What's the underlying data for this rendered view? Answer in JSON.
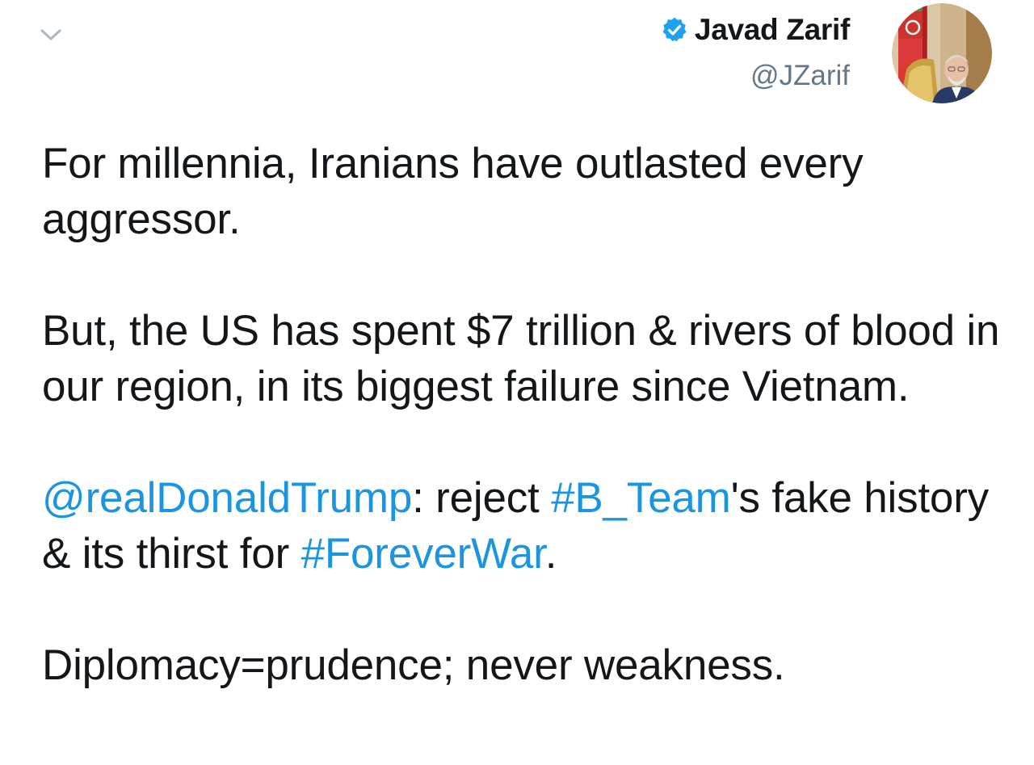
{
  "author": {
    "name": "Javad Zarif",
    "handle": "@JZarif",
    "verified": true,
    "verified_icon": "verified-badge-icon",
    "avatar_icon": "profile-avatar"
  },
  "header": {
    "menu_icon": "chevron-down-icon"
  },
  "tweet": {
    "paragraph_1": "For millennia, Iranians have outlasted every aggressor.",
    "paragraph_2": "But, the US has spent $7 trillion & rivers of blood in our region, in its biggest failure since Vietnam.",
    "paragraph_3": {
      "mention": "@realDonaldTrump",
      "text_1": ": reject ",
      "hashtag_1": "#B_Team",
      "text_2": "'s fake history & its thirst for ",
      "hashtag_2": "#ForeverWar",
      "text_3": "."
    },
    "paragraph_4": "Diplomacy=prudence; never weakness."
  },
  "colors": {
    "text": "#14171a",
    "secondary": "#657786",
    "link": "#1b95e0",
    "verified": "#1da1f2",
    "chevron": "#aab8c2"
  }
}
